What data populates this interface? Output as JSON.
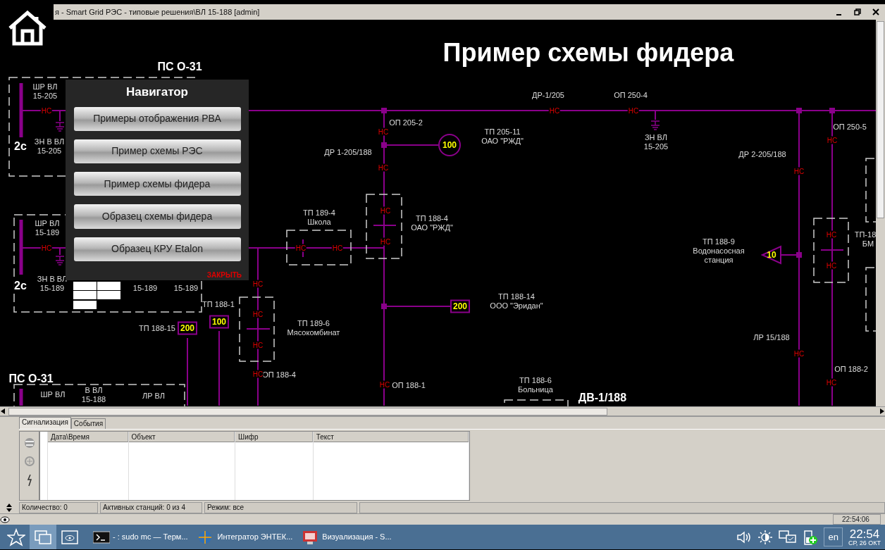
{
  "window": {
    "title": "я - Smart Grid РЭС - типовые решения\\ВЛ 15-188 [admin]"
  },
  "diagram": {
    "heading": "Пример схемы фидера",
    "labels": [
      {
        "kind": "station",
        "text": "ПС О-31"
      },
      {
        "kind": "label",
        "text": "ШР ВЛ\n15-205"
      },
      {
        "kind": "section",
        "text": "2с"
      },
      {
        "kind": "label",
        "text": "ЗН В ВЛ\n15-205"
      },
      {
        "kind": "label",
        "text": "ДР-1/205"
      },
      {
        "kind": "label",
        "text": "ОП 250-4"
      },
      {
        "kind": "label",
        "text": "ОП 205-2"
      },
      {
        "kind": "label",
        "text": "ТП 205-11\nОАО \"РЖД\""
      },
      {
        "kind": "label",
        "text": "ДР 1-205/188"
      },
      {
        "kind": "label",
        "text": "ЗН ВЛ\n15-205"
      },
      {
        "kind": "label",
        "text": "ДР 2-205/188"
      },
      {
        "kind": "label",
        "text": "ОП 250-5"
      },
      {
        "kind": "label",
        "text": "ШР ВЛ\n15-189"
      },
      {
        "kind": "label",
        "text": "ТП 189-4\nШкола"
      },
      {
        "kind": "label",
        "text": "ТП 188-4\nОАО \"РЖД\""
      },
      {
        "kind": "section",
        "text": "2с"
      },
      {
        "kind": "label",
        "text": "ЗН В ВЛ\n15-189"
      },
      {
        "kind": "label",
        "text": "15-189"
      },
      {
        "kind": "label",
        "text": "15-189"
      },
      {
        "kind": "label",
        "text": "ТП 188-9\nВодонасосная\nстанция"
      },
      {
        "kind": "label",
        "text": "ТП-18"
      },
      {
        "kind": "label",
        "text": "БМ"
      },
      {
        "kind": "label",
        "text": "ТП 188-1"
      },
      {
        "kind": "label",
        "text": "ТП 188-15"
      },
      {
        "kind": "label",
        "text": "ТП 189-6\nМясокомбинат"
      },
      {
        "kind": "label",
        "text": "ТП 188-14\nООО \"Эридан\""
      },
      {
        "kind": "label",
        "text": "ЛР 15/188"
      },
      {
        "kind": "label",
        "text": "ОП 188-4"
      },
      {
        "kind": "label",
        "text": "ОП 188-1"
      },
      {
        "kind": "label",
        "text": "ТП 188-6\nБольница"
      },
      {
        "kind": "label",
        "text": "ОП 188-2"
      },
      {
        "kind": "station",
        "text": "ДВ-1/188"
      },
      {
        "kind": "station",
        "text": "ПС О-31"
      },
      {
        "kind": "label",
        "text": "ШР ВЛ"
      },
      {
        "kind": "label",
        "text": "В ВЛ\n15-188"
      },
      {
        "kind": "label",
        "text": "ЛР ВЛ"
      }
    ],
    "switches": [
      "НС",
      "НС",
      "НС",
      "НС",
      "НС",
      "НС",
      "НС",
      "НС",
      "НС",
      "НС",
      "НС",
      "НС",
      "НС",
      "НС",
      "НС",
      "НС",
      "НС",
      "НС",
      "НС",
      "НС",
      "НС"
    ],
    "transformers": [
      {
        "kind": "circle",
        "text": "100"
      },
      {
        "kind": "box",
        "text": "200"
      },
      {
        "kind": "box",
        "text": "100"
      },
      {
        "kind": "box",
        "text": "200"
      },
      {
        "kind": "triangle",
        "text": "10"
      }
    ]
  },
  "navigator": {
    "title": "Навигатор",
    "buttons": [
      "Примеры отображения РВА",
      "Пример схемы РЭС",
      "Пример схемы фидера",
      "Образец схемы фидера",
      "Образец КРУ Etalon"
    ],
    "close": "ЗАКРЫТЬ"
  },
  "events_panel": {
    "tabs": [
      {
        "label": "Сигнализация",
        "selected": true
      },
      {
        "label": "События",
        "selected": false
      }
    ],
    "columns": [
      "Дата\\Время",
      "Объект",
      "Шифр",
      "Текст"
    ],
    "status": [
      "Количество: 0",
      "Активных станций: 0 из 4",
      "Режим: все"
    ],
    "clock": "22:54:06"
  },
  "taskbar": {
    "launchers": [
      {
        "kind": "favorites",
        "selected": false
      },
      {
        "kind": "windows",
        "selected": true
      },
      {
        "kind": "viewer",
        "selected": false
      }
    ],
    "tasks": [
      {
        "kind": "terminal",
        "label": "- : sudo mc — Терм..."
      },
      {
        "kind": "globe",
        "label": "Интегратор ЭНТЕК..."
      },
      {
        "kind": "app",
        "label": "Визуализация - S..."
      }
    ],
    "language": "en",
    "time": "22:54",
    "date": "СР, 26 ОКТ"
  }
}
